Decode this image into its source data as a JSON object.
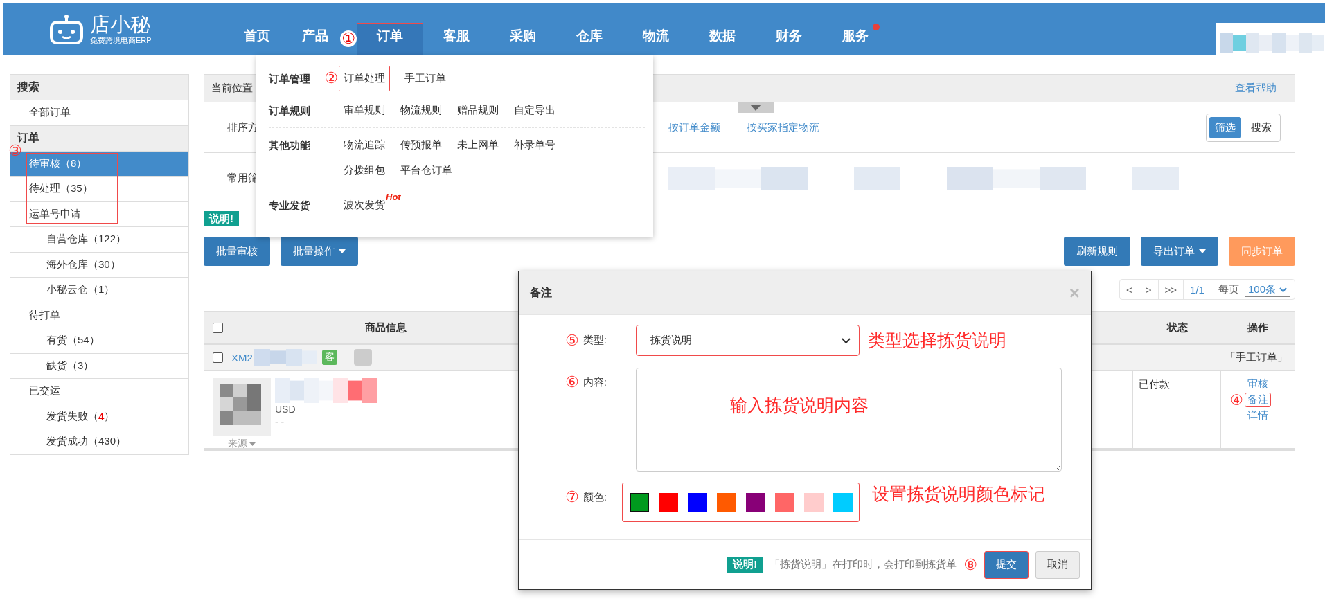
{
  "header": {
    "logo": {
      "name": "店小秘",
      "tagline": "免费跨境电商ERP"
    },
    "nav": [
      {
        "label": "首页",
        "selected": false
      },
      {
        "label": "产品",
        "selected": false
      },
      {
        "label": "订单",
        "selected": true,
        "highlighted": true,
        "marker": "①"
      },
      {
        "label": "客服",
        "selected": false
      },
      {
        "label": "采购",
        "selected": false
      },
      {
        "label": "仓库",
        "selected": false
      },
      {
        "label": "物流",
        "selected": false
      },
      {
        "label": "数据",
        "selected": false
      },
      {
        "label": "财务",
        "selected": false
      },
      {
        "label": "服务",
        "selected": false,
        "notification": true
      }
    ]
  },
  "sidebar": {
    "sections": [
      {
        "title": "搜索",
        "items": [
          {
            "label": "全部订单",
            "selected": false
          }
        ]
      },
      {
        "title": "订单",
        "marker": "③",
        "items": [
          {
            "label": "待审核（8）",
            "selected": true,
            "highlighted": true
          },
          {
            "label": "待处理（35）",
            "selected": false,
            "highlighted": true
          },
          {
            "label": "运单号申请",
            "selected": false,
            "highlighted": true,
            "children": [
              {
                "label": "自营仓库（122）",
                "selected": false
              },
              {
                "label": "海外仓库（30）",
                "selected": false
              },
              {
                "label": "小秘云仓（1）",
                "selected": false
              }
            ]
          },
          {
            "label": "待打单",
            "selected": false,
            "children": [
              {
                "label": "有货（54）",
                "selected": false
              },
              {
                "label": "缺货（3）",
                "selected": false
              }
            ]
          },
          {
            "label": "已交运",
            "selected": false,
            "children": [
              {
                "label": "发货失败（**4**）",
                "selected": false
              },
              {
                "label": "发货成功（430）",
                "selected": false
              }
            ]
          }
        ]
      }
    ]
  },
  "breadcrumb": {
    "label": "当前位置",
    "help_link": "查看帮助"
  },
  "filters": {
    "rows": [
      {
        "label": "排序方",
        "options": [
          {
            "label": "按订单金额"
          },
          {
            "label": "按买家指定物流"
          }
        ]
      },
      {
        "label": "常用筛"
      }
    ],
    "mode_tabs": [
      {
        "label": "筛选",
        "selected": true
      },
      {
        "label": "搜索",
        "selected": false
      }
    ]
  },
  "notice": {
    "badge": "说明!"
  },
  "toolbar": {
    "left": [
      {
        "label": "批量审核",
        "kind": "primary"
      },
      {
        "label": "批量操作",
        "kind": "primary",
        "dropdown": true
      }
    ],
    "right": [
      {
        "label": "刷新规则",
        "kind": "primary"
      },
      {
        "label": "导出订单",
        "kind": "primary",
        "dropdown": true
      },
      {
        "label": "同步订单",
        "kind": "warning"
      }
    ]
  },
  "pagination": {
    "buttons": [
      "<",
      ">",
      ">>"
    ],
    "page": "1/1",
    "per_page_label": "每页",
    "per_page": "100条"
  },
  "table": {
    "select_all": {
      "checked": false
    },
    "columns": [
      {
        "label": "商品信息"
      },
      {
        "label": "状态"
      },
      {
        "label": "操作"
      }
    ],
    "orders": [
      {
        "checked": false,
        "order_no": "XM2",
        "tag": "客",
        "source_tag": "「手工订单」",
        "product": {
          "price": "USD",
          "note": "- -",
          "source": "来源"
        },
        "status": "已付款",
        "actions": [
          {
            "label": "审核",
            "highlighted": false
          },
          {
            "label": "备注",
            "highlighted": true,
            "marker": "④"
          },
          {
            "label": "详情",
            "highlighted": false
          }
        ]
      }
    ]
  },
  "menu": {
    "groups": [
      {
        "title": "订单管理",
        "marker": "②",
        "items": [
          {
            "label": "订单处理",
            "highlighted": true
          },
          {
            "label": "手工订单",
            "highlighted": false
          }
        ]
      },
      {
        "title": "订单规则",
        "items": [
          {
            "label": "审单规则"
          },
          {
            "label": "物流规则"
          },
          {
            "label": "赠品规则"
          },
          {
            "label": "自定导出"
          }
        ]
      },
      {
        "title": "其他功能",
        "items": [
          {
            "label": "物流追踪"
          },
          {
            "label": "传预报单"
          },
          {
            "label": "未上网单"
          },
          {
            "label": "补录单号"
          },
          {
            "label": "分拨组包"
          },
          {
            "label": "平台仓订单"
          }
        ]
      },
      {
        "title": "专业发货",
        "items": [
          {
            "label": "波次发货",
            "badge": "Hot"
          }
        ]
      }
    ]
  },
  "dialog": {
    "title": "备注",
    "close": "×",
    "fields": [
      {
        "kind": "select",
        "marker": "⑤",
        "label": "类型:",
        "value": "拣货说明",
        "highlighted": true,
        "callout": "类型选择拣货说明"
      },
      {
        "kind": "textarea",
        "marker": "⑥",
        "label": "内容:",
        "callout": "输入拣货说明内容"
      },
      {
        "kind": "colors",
        "marker": "⑦",
        "label": "颜色:",
        "highlighted": true,
        "callout": "设置拣货说明颜色标记",
        "swatches": [
          {
            "color": "#009a1e",
            "selected": true
          },
          {
            "color": "#ff0000",
            "selected": false
          },
          {
            "color": "#0000ff",
            "selected": false
          },
          {
            "color": "#ff5a00",
            "selected": false
          },
          {
            "color": "#880077",
            "selected": false
          },
          {
            "color": "#ff6666",
            "selected": false
          },
          {
            "color": "#ffcccc",
            "selected": false
          },
          {
            "color": "#00ccff",
            "selected": false
          }
        ]
      }
    ],
    "footer": {
      "badge": "说明!",
      "note": "「拣货说明」在打印时，会打印到拣货单",
      "marker": "⑧",
      "buttons": [
        {
          "label": "提交",
          "kind": "primary",
          "highlighted": true
        },
        {
          "label": "取消",
          "kind": "default",
          "highlighted": false
        }
      ]
    }
  }
}
